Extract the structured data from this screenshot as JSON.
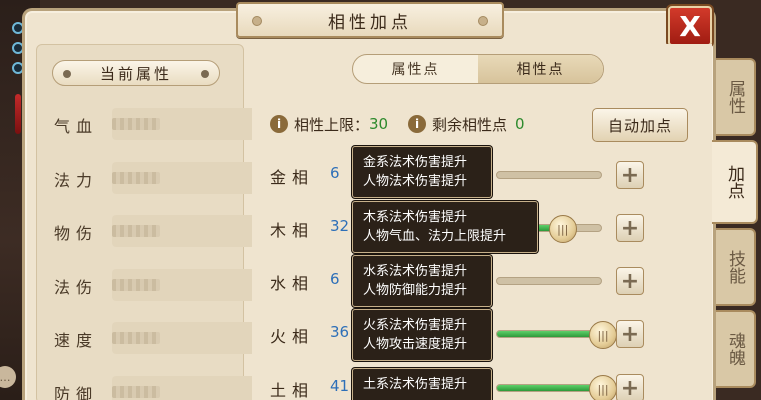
{
  "window": {
    "title": "相性加点",
    "close_label": "X"
  },
  "left_panel": {
    "header": "当前属性",
    "stats": [
      {
        "label": "气血"
      },
      {
        "label": "法力"
      },
      {
        "label": "物伤"
      },
      {
        "label": "法伤"
      },
      {
        "label": "速度"
      },
      {
        "label": "防御"
      }
    ]
  },
  "tabs": [
    {
      "label": "属性点",
      "active": false
    },
    {
      "label": "相性点",
      "active": true
    }
  ],
  "info": {
    "limit_label": "相性上限：",
    "limit_value": "30",
    "remaining_label": "剩余相性点",
    "remaining_value": "0",
    "info_icon": "i"
  },
  "auto_button": "自动加点",
  "affinities": [
    {
      "name": "金相",
      "value": "6",
      "level": 0.0,
      "tip1": "金系法术伤害提升",
      "tip2": "人物法术伤害提升"
    },
    {
      "name": "木相",
      "value": "32",
      "level": 0.62,
      "tip1": "木系法术伤害提升",
      "tip2": "人物气血、法力上限提升"
    },
    {
      "name": "水相",
      "value": "6",
      "level": 0.0,
      "tip1": "水系法术伤害提升",
      "tip2": "人物防御能力提升"
    },
    {
      "name": "火相",
      "value": "36",
      "level": 1.0,
      "tip1": "火系法术伤害提升",
      "tip2": "人物攻击速度提升"
    },
    {
      "name": "土相",
      "value": "41",
      "level": 1.0,
      "tip1": "土系法术伤害提升",
      "tip2": ""
    }
  ],
  "side_tabs": [
    {
      "label": "属性",
      "active": false
    },
    {
      "label": "加点",
      "active": true
    },
    {
      "label": "技能",
      "active": false
    },
    {
      "label": "魂魄",
      "active": false
    }
  ],
  "chat_label": "…",
  "icons": {
    "close": "close-icon",
    "info": "info-icon",
    "plus": "plus-icon",
    "slider_knob": "slider-knob-icon"
  },
  "colors": {
    "panel_bg": "#efe4cf",
    "accent_green": "#2d9a3a",
    "value_blue": "#2d6fb8",
    "close_red": "#c42a2a"
  }
}
